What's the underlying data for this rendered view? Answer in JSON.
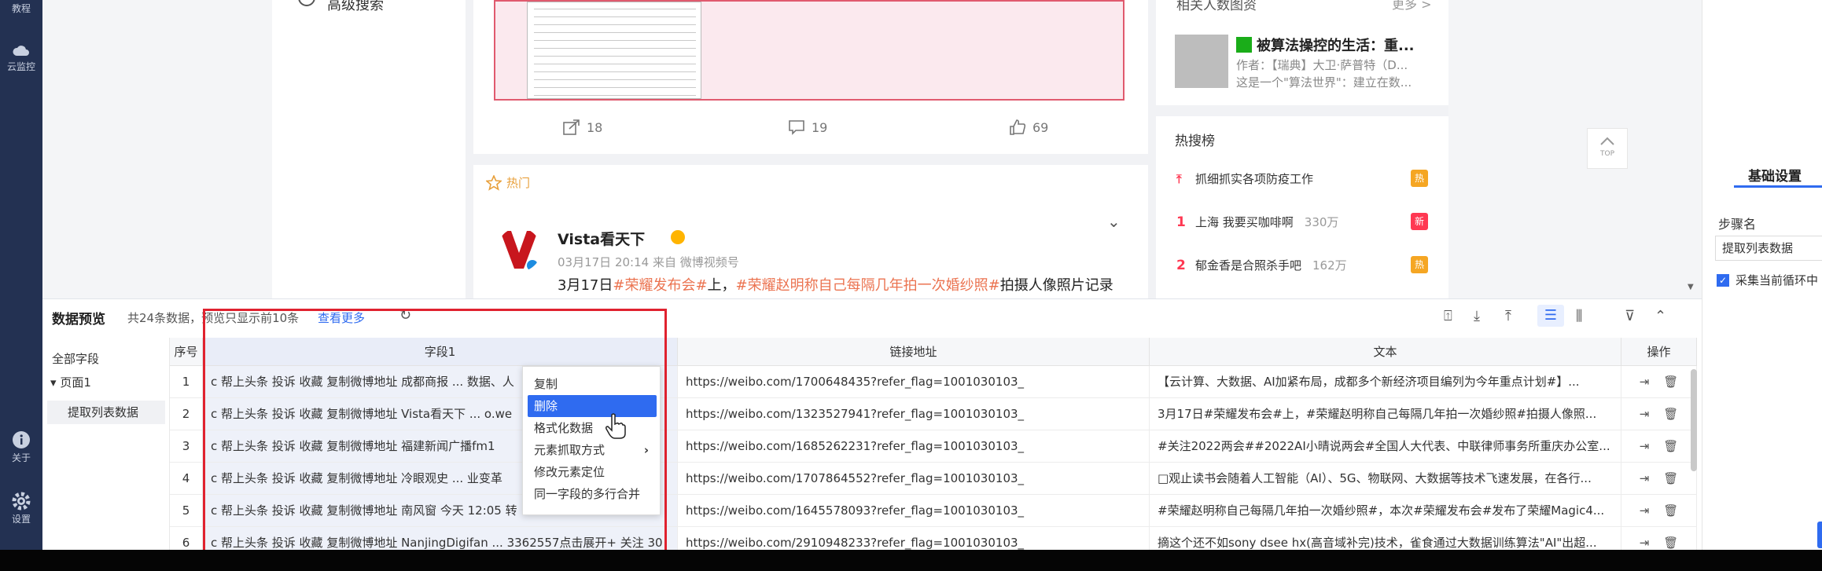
{
  "nav": {
    "items": [
      {
        "label": "教程",
        "icon": "book-icon"
      },
      {
        "label": "云监控",
        "icon": "cloud-icon"
      },
      {
        "label": "关于",
        "icon": "info-icon"
      },
      {
        "label": "设置",
        "icon": "gear-icon"
      }
    ]
  },
  "web": {
    "advanced_search": "高级搜索",
    "actions": {
      "share": "18",
      "comment": "19",
      "like": "69"
    },
    "hot_tag": "热门",
    "post": {
      "user": "Vista看天下",
      "meta": "03月17日 20:14 来自 微博视频号",
      "text_plain1": "3月17日",
      "text_hl1": "#荣耀发布会#",
      "text_plain2": "上，",
      "text_hl2": "#荣耀赵明称自己每隔几年拍一次婚纱照#",
      "text_plain3": "拍摄人像照片记录"
    },
    "related": {
      "title": "相关人数图资",
      "more": "更多 >",
      "book_title": "被算法操控的生活：重...",
      "book_author": "作者：【瑞典】大卫·萨普特（D...",
      "book_desc": "这是一个\"算法世界\"：建立在数..."
    },
    "hot_list": {
      "title": "热搜榜",
      "items": [
        {
          "rank": "",
          "text": "抓细抓实各项防疫工作",
          "count": "",
          "badge": "热",
          "badge_color": "#f5a623"
        },
        {
          "rank": "1",
          "text": "上海 我要买咖啡啊",
          "count": "330万",
          "badge": "新",
          "badge_color": "#ff3852"
        },
        {
          "rank": "2",
          "text": "郁金香是合照杀手吧",
          "count": "162万",
          "badge": "热",
          "badge_color": "#f5a623"
        }
      ]
    },
    "top_label": "TOP"
  },
  "settings": {
    "tab": "基础设置",
    "step_name_label": "步骤名",
    "step_name_value": "提取列表数据",
    "checkbox_label": "采集当前循环中"
  },
  "data_preview": {
    "title": "数据预览",
    "summary": "共24条数据，预览只显示前10条",
    "view_more": "查看更多",
    "tree": {
      "all": "全部字段",
      "page": "页面1",
      "step": "提取列表数据"
    },
    "columns": [
      "序号",
      "字段1",
      "链接地址",
      "文本",
      "操作"
    ],
    "rows": [
      {
        "no": "1",
        "f1": "c 帮上头条 投诉 收藏 复制微博地址 成都商报 ... 数据、人",
        "link": "https://weibo.com/1700648435?refer_flag=1001030103_",
        "text": "【云计算、大数据、AI加紧布局，成都多个新经济项目编列为今年重点计划#】..."
      },
      {
        "no": "2",
        "f1": "c 帮上头条 投诉 收藏 复制微博地址 Vista看天下 ... o.we",
        "link": "https://weibo.com/1323527941?refer_flag=1001030103_",
        "text": "3月17日#荣耀发布会#上，#荣耀赵明称自己每隔几年拍一次婚纱照#拍摄人像照..."
      },
      {
        "no": "3",
        "f1": "c 帮上头条 投诉 收藏 复制微博地址 福建新闻广播fm1",
        "link": "https://weibo.com/1685262231?refer_flag=1001030103_",
        "text": "#关注2022两会##2022AI小晴说两会#全国人大代表、中联律师事务所重庆办公室..."
      },
      {
        "no": "4",
        "f1": "c 帮上头条 投诉 收藏 复制微博地址 冷眼观史 ... 业变革",
        "link": "https://weibo.com/1707864552?refer_flag=1001030103_",
        "text": "□观止读书会随着人工智能（AI）、5G、物联网、大数据等技术飞速发展，在各行..."
      },
      {
        "no": "5",
        "f1": "c 帮上头条 投诉 收藏 复制微博地址 南风窗 今天 12:05 转",
        "link": "https://weibo.com/1645578093?refer_flag=1001030103_",
        "text": "#荣耀赵明称自己每隔几年拍一次婚纱照#，本次#荣耀发布会#发布了荣耀Magic4..."
      },
      {
        "no": "6",
        "f1": "c 帮上头条 投诉 收藏 复制微博地址 NanjingDigifan ... 3362557点击展开+ 关注 30",
        "link": "https://weibo.com/2910948233?refer_flag=1001030103_",
        "text": "摘这个还不如sony dsee hx(高音域补完)技术，雀食通过大数据训练算法\"AI\"出超..."
      }
    ]
  },
  "context_menu": {
    "items": [
      "复制",
      "删除",
      "格式化数据",
      "元素抓取方式",
      "修改元素定位",
      "同一字段的多行合并"
    ],
    "selected_index": 1
  }
}
